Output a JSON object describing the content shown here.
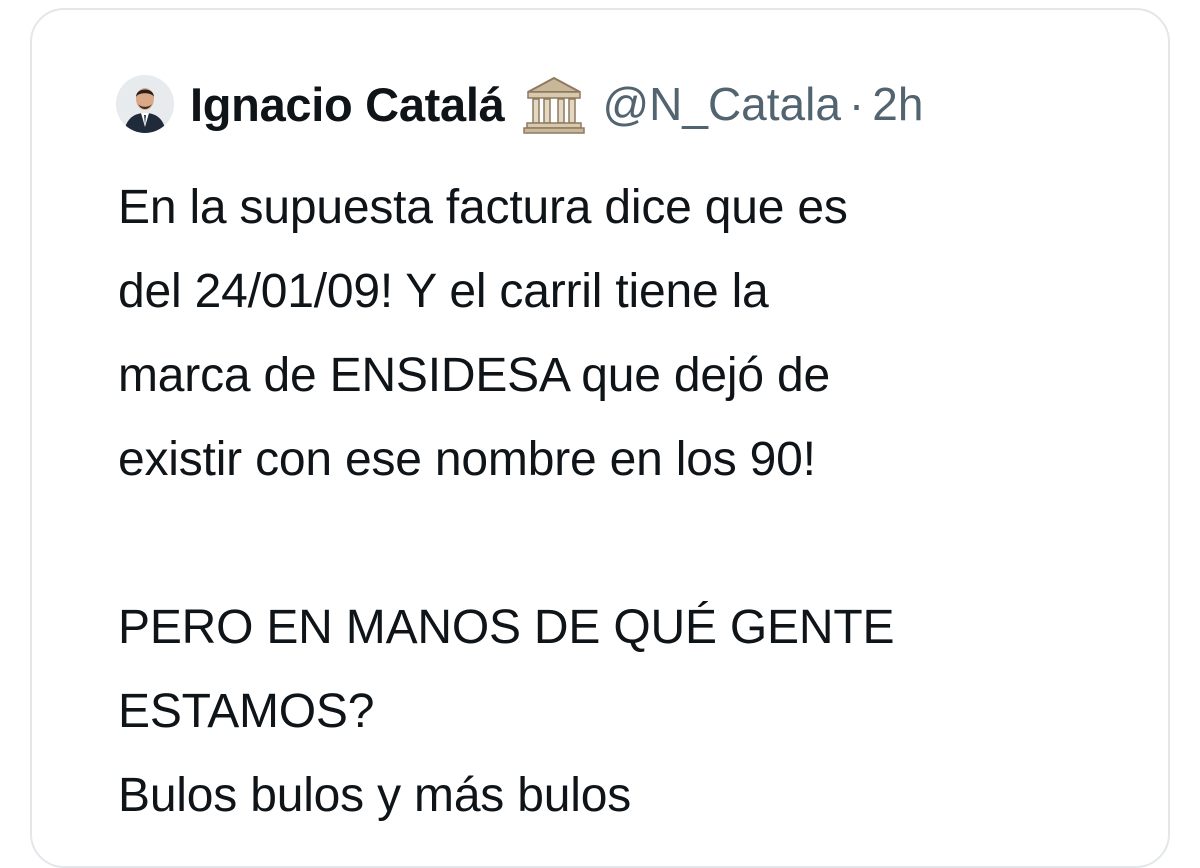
{
  "tweet": {
    "author": {
      "display_name": "Ignacio Catalá",
      "handle": "@N_Catala",
      "badge_icon": "classical-building-icon"
    },
    "separator": "·",
    "timestamp": "2h",
    "text": {
      "paragraph1": [
        "En la supuesta factura dice que es",
        "del 24/01/09! Y el carril tiene la",
        "marca de ENSIDESA que dejó de",
        "existir con ese nombre en los 90!"
      ],
      "paragraph2": [
        "PERO EN MANOS DE QUÉ GENTE",
        "ESTAMOS?",
        "Bulos bulos y más bulos"
      ]
    }
  },
  "colors": {
    "text_primary": "#0f1419",
    "text_secondary": "#536471",
    "card_border": "#e3e7ea"
  }
}
